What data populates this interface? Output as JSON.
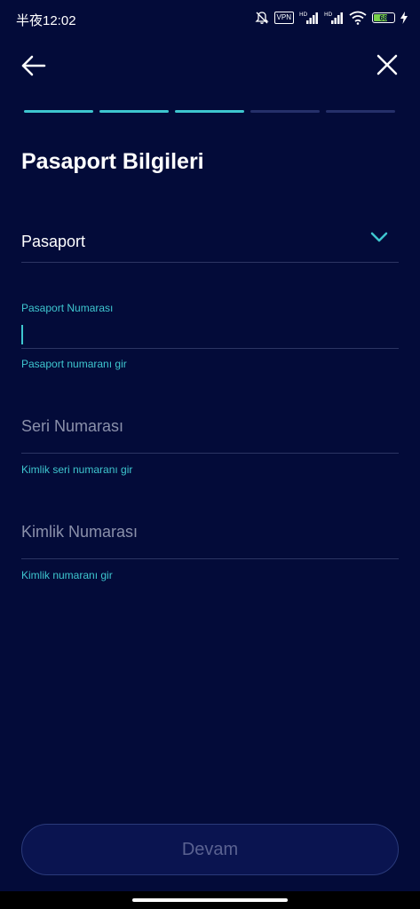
{
  "status_bar": {
    "time": "半夜12:02",
    "vpn": "VPN",
    "battery_level": "68",
    "battery_fraction": 0.68
  },
  "nav": {
    "back_icon": "arrow-left-icon",
    "close_icon": "close-icon"
  },
  "progress": {
    "total_steps": 5,
    "completed_steps": 3,
    "active_color": "#3ec6cf",
    "inactive_color": "#25306a"
  },
  "page": {
    "title": "Pasaport Bilgileri"
  },
  "document_type": {
    "value": "Pasaport",
    "icon": "chevron-down-icon"
  },
  "fields": {
    "passport_number": {
      "label": "Pasaport Numarası",
      "value": "",
      "helper": "Pasaport numaranı gir"
    },
    "serial_number": {
      "placeholder": "Seri Numarası",
      "helper": "Kimlik seri numaranı gir"
    },
    "id_number": {
      "placeholder": "Kimlik Numarası",
      "helper": "Kimlik numaranı gir"
    }
  },
  "cta": {
    "label": "Devam"
  },
  "colors": {
    "background": "#030b39",
    "accent": "#3ec6cf",
    "divider": "#2c3563"
  }
}
